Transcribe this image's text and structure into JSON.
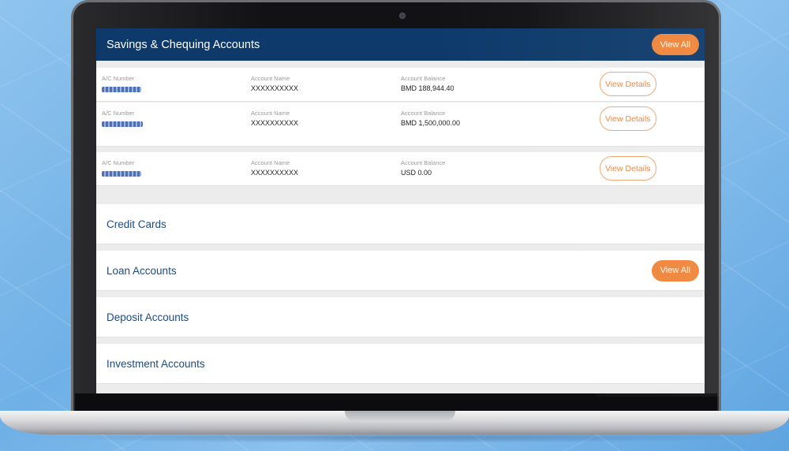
{
  "savings": {
    "title": "Savings & Chequing Accounts",
    "view_all": "View All",
    "column_labels": {
      "number": "A/C Number",
      "name": "Account Name",
      "balance": "Account Balance"
    },
    "accounts": [
      {
        "name": "XXXXXXXXXX",
        "balance": "BMD 188,944.40",
        "details": "View Details"
      },
      {
        "name": "XXXXXXXXXX",
        "balance": "BMD 1,500,000.00",
        "details": "View Details"
      },
      {
        "name": "XXXXXXXXXX",
        "balance": "USD 0.00",
        "details": "View Details"
      }
    ]
  },
  "sections": {
    "credit": "Credit Cards",
    "loan": "Loan Accounts",
    "loan_view_all": "View All",
    "deposit": "Deposit Accounts",
    "investment": "Investment Accounts"
  },
  "colors": {
    "header": "#0d3a6b",
    "accent": "#f0843a",
    "section_title": "#1c4a80"
  }
}
